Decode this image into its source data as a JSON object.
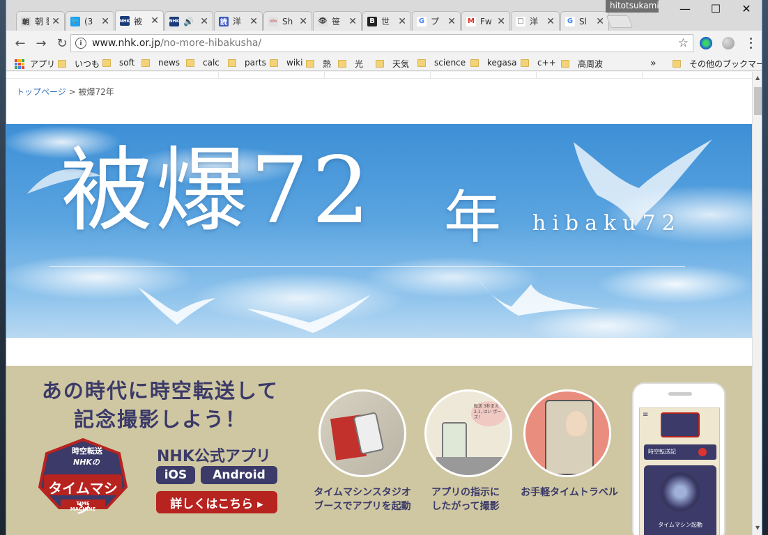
{
  "window": {
    "user_badge": "hitotsukami",
    "minimize": "—",
    "maximize": "☐",
    "close": "✕"
  },
  "tabs": [
    {
      "favicon": "朝",
      "title": "朝 鑒",
      "fav_bg": "#d9d9d9",
      "fav_color": "#333"
    },
    {
      "favicon": "🐦",
      "title": "(3",
      "fav_bg": "#1da1f2",
      "fav_color": "#fff"
    },
    {
      "favicon": "NHK",
      "title": "被",
      "fav_bg": "#1a3c7a",
      "fav_color": "#fff",
      "active": true
    },
    {
      "favicon": "NHK",
      "title": "🔊",
      "fav_bg": "#1a3c7a",
      "fav_color": "#fff"
    },
    {
      "favicon": "読",
      "title": "洋",
      "fav_bg": "#3b57c4",
      "fav_color": "#fff"
    },
    {
      "favicon": "olo",
      "title": "Sh",
      "fav_bg": "#e0e0e0",
      "fav_color": "#c77"
    },
    {
      "favicon": "👁",
      "title": "笹",
      "fav_bg": "#e0e0e0",
      "fav_color": "#333"
    },
    {
      "favicon": "B",
      "title": "世",
      "fav_bg": "#222",
      "fav_color": "#fff"
    },
    {
      "favicon": "G",
      "title": "プ",
      "fav_bg": "#fff",
      "fav_color": "#4285f4"
    },
    {
      "favicon": "M",
      "title": "Fw",
      "fav_bg": "#fff",
      "fav_color": "#d93025"
    },
    {
      "favicon": "□",
      "title": "洋",
      "fav_bg": "#fff",
      "fav_color": "#555"
    },
    {
      "favicon": "G",
      "title": "Sl",
      "fav_bg": "#fff",
      "fav_color": "#4285f4"
    }
  ],
  "toolbar": {
    "back": "←",
    "forward": "→",
    "reload": "↻",
    "url_host": "www.nhk.or.jp",
    "url_path": "/no-more-hibakusha/",
    "bookmark_star": "☆"
  },
  "bookmarks": {
    "apps_label": "アプリ",
    "items": [
      "いつも",
      "soft",
      "news",
      "calc",
      "parts",
      "wiki",
      "熱",
      "光",
      "天気",
      "science",
      "kegasa",
      "c++",
      "高周波"
    ],
    "overflow": "»",
    "other": "その他のブックマーク"
  },
  "page": {
    "breadcrumb_home": "トップページ",
    "breadcrumb_sep": ">",
    "breadcrumb_current": "被爆72年",
    "hero_title": "被爆72",
    "hero_year": "年",
    "hero_sub": "hibaku72",
    "promo": {
      "headline_1": "あの時代に時空転送して",
      "headline_2": "記念撮影しよう！",
      "logo_top": "時空転送",
      "logo_nhk": "NHKの",
      "logo_main": "タイムマシン",
      "logo_en": "TIME MACHINE",
      "app_title": "NHK公式アプリ",
      "ios": "iOS",
      "android": "Android",
      "more": "詳しくはこちら ▸",
      "steps": [
        {
          "caption_1": "タイムマシンスタジオ",
          "caption_2": "ブースでアプリを起動"
        },
        {
          "caption_1": "アプリの指示に",
          "caption_2": "したがって撮影",
          "bubble": "転送 3秒まえ 2,1, はい ポーズ！"
        },
        {
          "caption_1": "お手軽タイムトラベル",
          "caption_2": ""
        }
      ],
      "phone_label_1": "時空転送記",
      "phone_label_2": "タイムマシン起動"
    }
  },
  "colors": {
    "promo_bg": "#cfc7a2",
    "promo_ink": "#3b3a68",
    "more_button": "#b7231f",
    "link": "#3a78c0"
  }
}
